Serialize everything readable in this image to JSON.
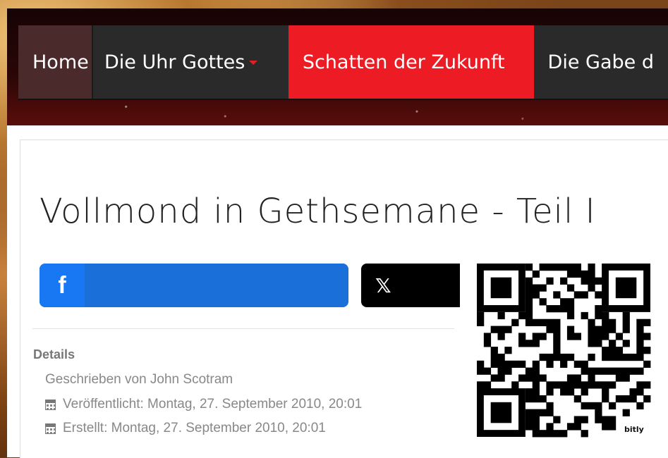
{
  "nav": {
    "home": "Home",
    "uhr": "Die Uhr Gottes",
    "active": "Schatten der Zukunft",
    "gabe": "Die Gabe d"
  },
  "article": {
    "title": "Vollmond in Gethsemane - Teil I",
    "details_label": "Details",
    "author": "Geschrieben von John Scotram",
    "published": "Veröffentlicht: Montag, 27. September 2010, 20:01",
    "created": "Erstellt: Montag, 27. September 2010, 20:01"
  },
  "share": {
    "facebook_icon": "f",
    "x_icon": "𝕏"
  },
  "qr": {
    "brand": "bitly"
  },
  "colors": {
    "nav_bg": "#2a2a2a",
    "nav_active": "#ed1c24",
    "facebook": "#1877f2",
    "x": "#000000"
  }
}
